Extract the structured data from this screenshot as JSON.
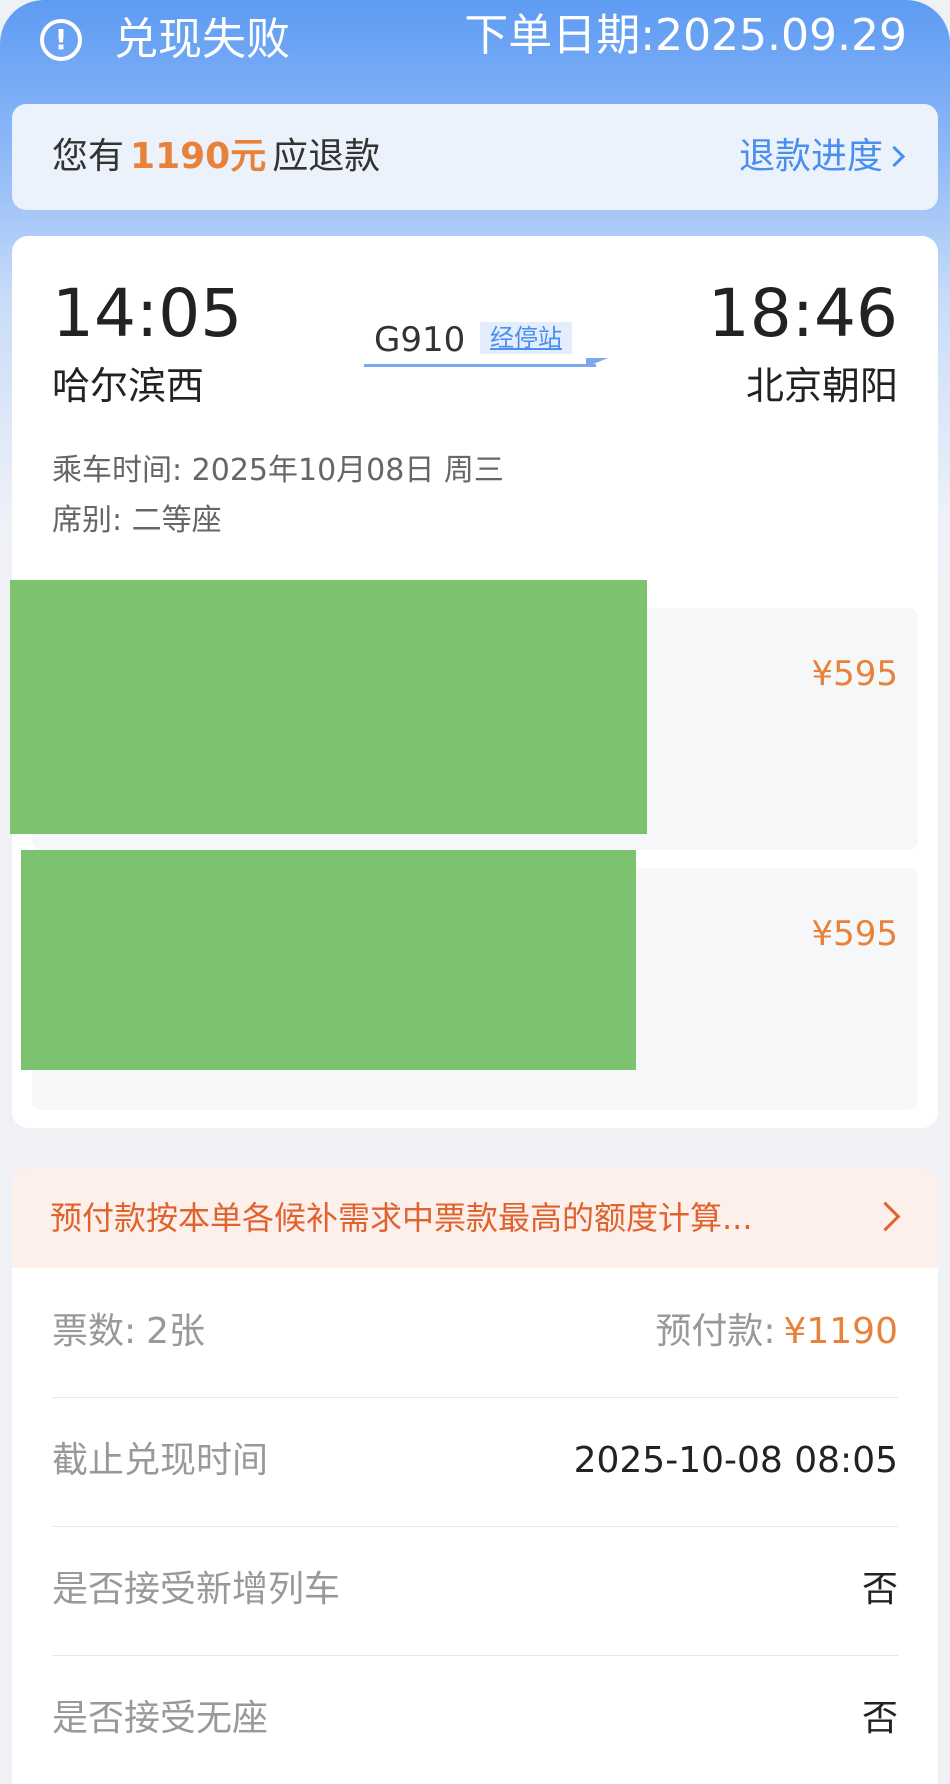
{
  "header": {
    "status_icon": "exclamation-circle-icon",
    "status_title": "兑现失败",
    "order_date": "下单日期:2025.09.29"
  },
  "refund": {
    "prefix": "您有",
    "amount": "1190元",
    "suffix": "应退款",
    "progress_label": "退款进度"
  },
  "trip": {
    "departure_time": "14:05",
    "departure_station": "哈尔滨西",
    "arrival_time": "18:46",
    "arrival_station": "北京朝阳",
    "train_number": "G910",
    "stops_link": "经停站",
    "ride_time": "乘车时间: 2025年10月08日 周三",
    "seat_class": "席别: 二等座"
  },
  "passengers": [
    {
      "price": "¥595"
    },
    {
      "price": "¥595"
    }
  ],
  "notice": {
    "text": "预付款按本单各候补需求中票款最高的额度计算..."
  },
  "details": {
    "tickets_label": "票数:",
    "tickets_value": "2张",
    "prepay_label": "预付款:",
    "prepay_value": "¥1190",
    "deadline_label": "截止兑现时间",
    "deadline_value": "2025-10-08 08:05",
    "new_train_label": "是否接受新增列车",
    "new_train_value": "否",
    "no_seat_label": "是否接受无座",
    "no_seat_value": "否"
  },
  "colors": {
    "header_blue": "#5d9bf3",
    "accent_orange": "#e8813a",
    "link_blue": "#4a8ef0",
    "notice_bg": "#fdf0ea",
    "notice_text": "#e0632f",
    "redaction_green": "#7dc26f"
  }
}
